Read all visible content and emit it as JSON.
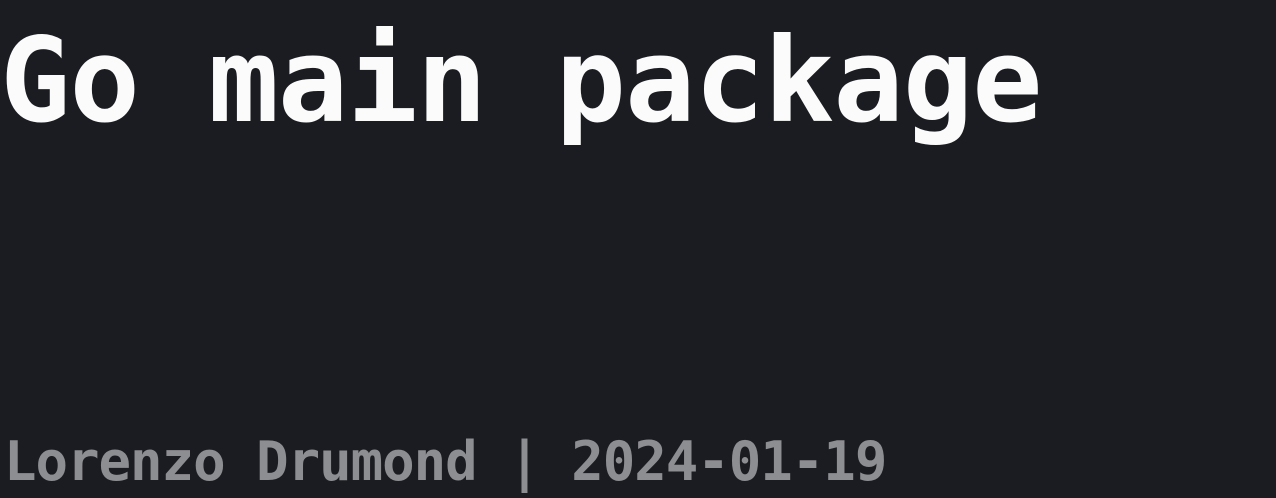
{
  "post": {
    "title": "Go main package",
    "author": "Lorenzo Drumond",
    "separator": "|",
    "date": "2024-01-19"
  },
  "colors": {
    "background": "#1b1c21",
    "title": "#fbfbfb",
    "byline": "#8d8e92"
  }
}
